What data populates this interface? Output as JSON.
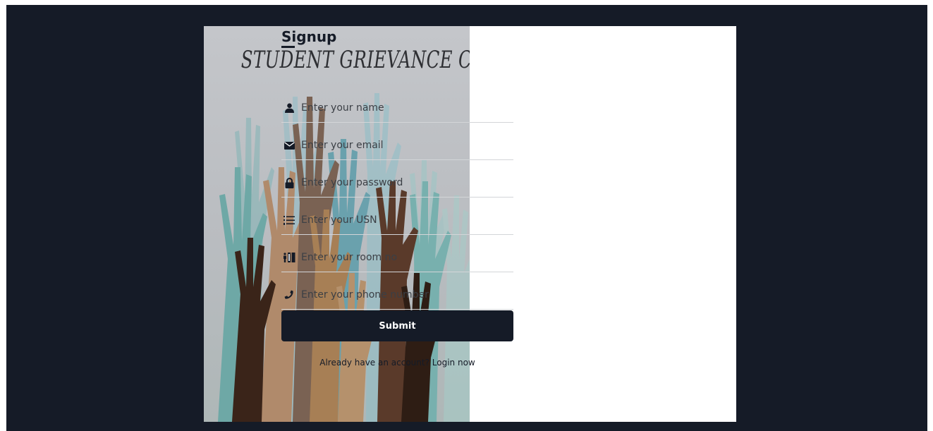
{
  "hero": {
    "title": "STUDENT GRIEVANCE CELL"
  },
  "form": {
    "title": "Signup",
    "fields": [
      {
        "icon": "user-icon",
        "placeholder": "Enter your name"
      },
      {
        "icon": "envelope-icon",
        "placeholder": "Enter your email"
      },
      {
        "icon": "lock-icon",
        "placeholder": "Enter your password"
      },
      {
        "icon": "list-icon",
        "placeholder": "Enter your USN"
      },
      {
        "icon": "room-icon",
        "placeholder": "Enter your room no"
      },
      {
        "icon": "phone-icon",
        "placeholder": "Enter your phone number"
      }
    ],
    "submit_label": "Submit",
    "login_prompt": "Already have an account?",
    "login_link": "Login now"
  },
  "colors": {
    "background": "#151b27",
    "primary": "#151b27",
    "card": "#ffffff"
  }
}
